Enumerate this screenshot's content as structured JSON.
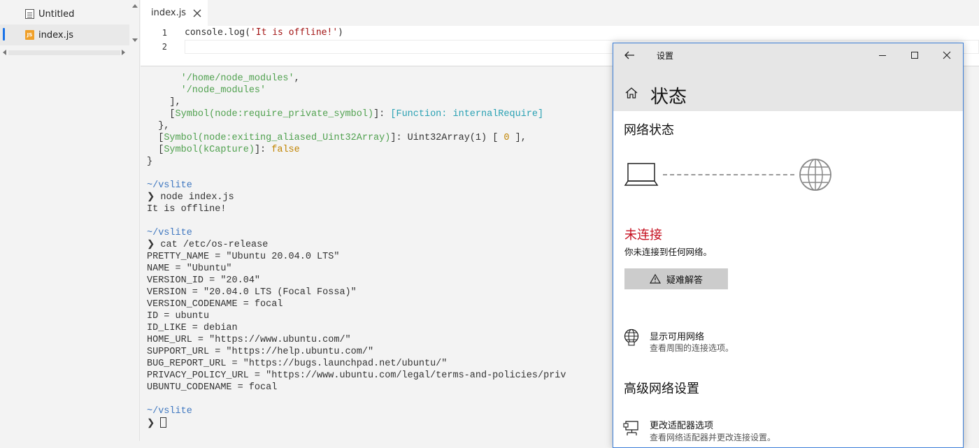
{
  "sidebar": {
    "files": [
      {
        "name": "Untitled",
        "icon": "file-text-icon",
        "active": false
      },
      {
        "name": "index.js",
        "icon": "js-file-icon",
        "icon_text": "JS",
        "active": true
      }
    ]
  },
  "editor": {
    "tab_label": "index.js",
    "lines": [
      {
        "number": "1",
        "code_prefix": "console.log(",
        "code_string": "'It is offline!'",
        "code_suffix": ")"
      },
      {
        "number": "2",
        "code_prefix": "",
        "code_string": "",
        "code_suffix": ""
      }
    ]
  },
  "terminal": {
    "lines": [
      [
        {
          "t": "      ",
          "c": ""
        },
        {
          "t": "'/home/node_modules'",
          "c": "t-green"
        },
        {
          "t": ",",
          "c": ""
        }
      ],
      [
        {
          "t": "      ",
          "c": ""
        },
        {
          "t": "'/node_modules'",
          "c": "t-green"
        }
      ],
      [
        {
          "t": "    ],",
          "c": ""
        }
      ],
      [
        {
          "t": "    [",
          "c": ""
        },
        {
          "t": "Symbol(node:require_private_symbol)",
          "c": "t-green"
        },
        {
          "t": "]: ",
          "c": ""
        },
        {
          "t": "[Function: internalRequire]",
          "c": "t-cyan"
        }
      ],
      [
        {
          "t": "  },",
          "c": ""
        }
      ],
      [
        {
          "t": "  [",
          "c": ""
        },
        {
          "t": "Symbol(node:exiting_aliased_Uint32Array)",
          "c": "t-green"
        },
        {
          "t": "]: Uint32Array(1) [ ",
          "c": ""
        },
        {
          "t": "0",
          "c": "t-yellow"
        },
        {
          "t": " ],",
          "c": ""
        }
      ],
      [
        {
          "t": "  [",
          "c": ""
        },
        {
          "t": "Symbol(kCapture)",
          "c": "t-green"
        },
        {
          "t": "]: ",
          "c": ""
        },
        {
          "t": "false",
          "c": "t-yellow"
        }
      ],
      [
        {
          "t": "}",
          "c": ""
        }
      ],
      [],
      [
        {
          "t": "~/vslite",
          "c": "t-blue"
        }
      ],
      [
        {
          "t": "❯ ",
          "c": "t-prompt"
        },
        {
          "t": "node index.js",
          "c": ""
        }
      ],
      [
        {
          "t": "It is offline!",
          "c": ""
        }
      ],
      [],
      [
        {
          "t": "~/vslite",
          "c": "t-blue"
        }
      ],
      [
        {
          "t": "❯ ",
          "c": "t-prompt"
        },
        {
          "t": "cat /etc/os-release",
          "c": ""
        }
      ],
      [
        {
          "t": "PRETTY_NAME = \"Ubuntu 20.04.0 LTS\"",
          "c": ""
        }
      ],
      [
        {
          "t": "NAME = \"Ubuntu\"",
          "c": ""
        }
      ],
      [
        {
          "t": "VERSION_ID = \"20.04\"",
          "c": ""
        }
      ],
      [
        {
          "t": "VERSION = \"20.04.0 LTS (Focal Fossa)\"",
          "c": ""
        }
      ],
      [
        {
          "t": "VERSION_CODENAME = focal",
          "c": ""
        }
      ],
      [
        {
          "t": "ID = ubuntu",
          "c": ""
        }
      ],
      [
        {
          "t": "ID_LIKE = debian",
          "c": ""
        }
      ],
      [
        {
          "t": "HOME_URL = \"https://www.ubuntu.com/\"",
          "c": ""
        }
      ],
      [
        {
          "t": "SUPPORT_URL = \"https://help.ubuntu.com/\"",
          "c": ""
        }
      ],
      [
        {
          "t": "BUG_REPORT_URL = \"https://bugs.launchpad.net/ubuntu/\"",
          "c": ""
        }
      ],
      [
        {
          "t": "PRIVACY_POLICY_URL = \"https://www.ubuntu.com/legal/terms-and-policies/priv",
          "c": ""
        }
      ],
      [
        {
          "t": "UBUNTU_CODENAME = focal",
          "c": ""
        }
      ],
      [],
      [
        {
          "t": "~/vslite",
          "c": "t-blue"
        }
      ],
      [
        {
          "t": "❯ ",
          "c": "t-prompt"
        },
        {
          "t": "",
          "c": "cursor"
        }
      ]
    ]
  },
  "settings": {
    "window_title": "设置",
    "page_title": "状态",
    "network_status_heading": "网络状态",
    "connection_status": "未连接",
    "connection_desc": "你未连接到任何网络。",
    "troubleshoot_label": "疑难解答",
    "show_networks_title": "显示可用网络",
    "show_networks_sub": "查看周围的连接选项。",
    "advanced_heading": "高级网络设置",
    "adapter_title": "更改适配器选项",
    "adapter_sub": "查看网络适配器并更改连接设置。",
    "colors": {
      "status_red": "#c50f1f",
      "accent_border": "#3c7fd8"
    }
  }
}
